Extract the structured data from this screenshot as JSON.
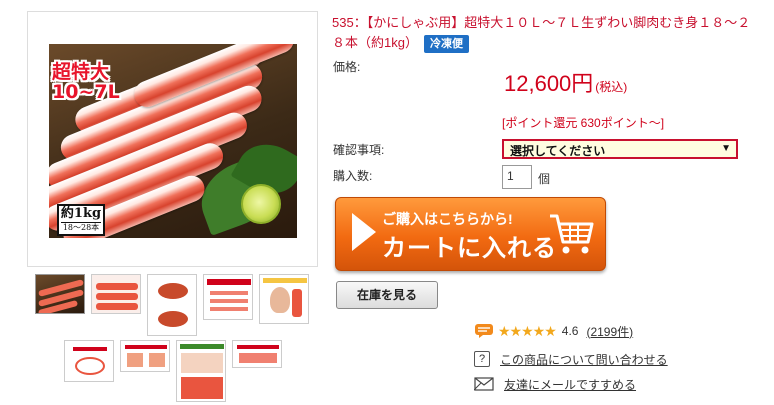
{
  "product": {
    "title": "535：【かにしゃぶ用】超特大１０Ｌ～７Ｌ生ずわい脚肉むき身１８～２８本（約1kg）",
    "shipping_badge": "冷凍便",
    "image_badge_line1": "超特大",
    "image_badge_line2": "10~7L",
    "image_weight_line1": "約1kg",
    "image_weight_line2": "18～28本"
  },
  "labels": {
    "price": "価格:",
    "confirm": "確認事項:",
    "quantity": "購入数:"
  },
  "price": {
    "amount": "12,600円",
    "tax": "(税込)",
    "points": "[ポイント還元 630ポイント～]"
  },
  "options": {
    "selected": "選択してください"
  },
  "quantity": {
    "value": "1",
    "unit": "個"
  },
  "cart_button": {
    "line1": "ご購入はこちらから!",
    "line2": "カートに入れる"
  },
  "stock_button": "在庫を見る",
  "review": {
    "rating": "4.6",
    "count": "(2199件)",
    "stars": "★★★★★"
  },
  "links": {
    "inquiry": "この商品について問い合わせる",
    "email": "友達にメールですすめる"
  },
  "icons": {
    "chat": "chat-bubble-icon",
    "question": "question-icon",
    "mail": "envelope-icon",
    "cart": "cart-icon"
  },
  "colors": {
    "accent_red": "#d0021b",
    "cart_orange": "#f26a11",
    "badge_blue": "#1f6fc5",
    "star_gold": "#f2a81d"
  }
}
